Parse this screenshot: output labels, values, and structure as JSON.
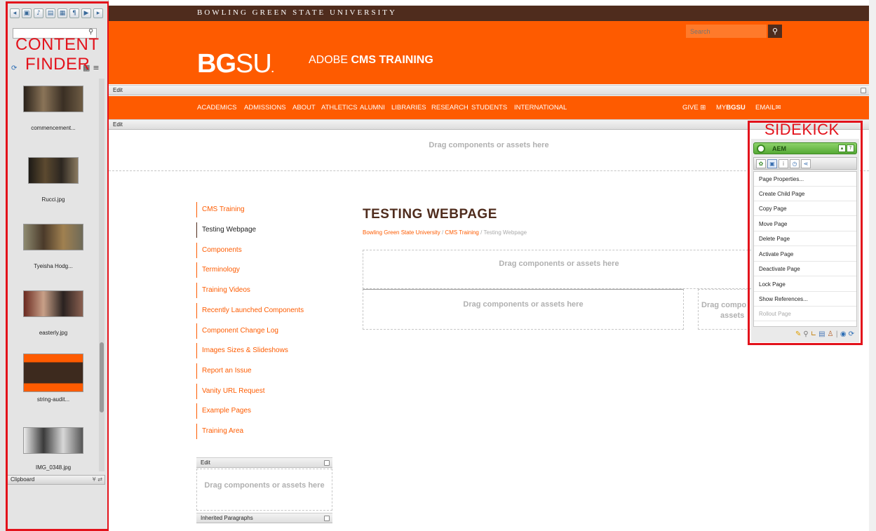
{
  "annotations": {
    "content_finder_line1": "CONTENT",
    "content_finder_line2": "FINDER",
    "sidekick": "SIDEKICK",
    "outline_color": "#e3121b"
  },
  "content_finder": {
    "toolbar_icons": [
      "back-icon",
      "image-icon",
      "document-icon",
      "page-icon",
      "product-icon",
      "paragraph-icon",
      "movie-icon",
      "forward-icon"
    ],
    "search_placeholder": "",
    "assets": [
      {
        "caption": "commencement...",
        "thumb_color": "#5a4c3a"
      },
      {
        "caption": "Rucci.jpg",
        "thumb_color": "#3b332a"
      },
      {
        "caption": "Tyeisha Hodg...",
        "thumb_color": "#8a7a60"
      },
      {
        "caption": "easterly.jpg",
        "thumb_color": "#7a3a2a"
      },
      {
        "caption": "string-audit...",
        "thumb_color": "#3d2a1e"
      },
      {
        "caption": "IMG_0348.jpg",
        "thumb_color": "#6a6a6a"
      }
    ],
    "clipboard_label": "Clipboard"
  },
  "header": {
    "university_name": "BOWLING GREEN STATE UNIVERSITY",
    "logo_bold": "BG",
    "logo_rest": "SU",
    "logo_mark": ".",
    "site_title_light": "ADOBE ",
    "site_title_bold": "CMS TRAINING",
    "search_placeholder": "Search",
    "brand_orange": "#fe5b00",
    "brand_brown": "#4f2c1d"
  },
  "edit_bars": {
    "header_edit": "Edit",
    "nav_edit": "Edit",
    "sidebar_edit": "Edit",
    "inherited_paragraphs": "Inherited Paragraphs"
  },
  "nav": {
    "items": [
      "ACADEMICS",
      "ADMISSIONS",
      "ABOUT",
      "ATHLETICS",
      "ALUMNI",
      "LIBRARIES",
      "RESEARCH",
      "STUDENTS",
      "INTERNATIONAL"
    ],
    "give": "GIVE",
    "my_prefix": "MY",
    "my_bold": "BGSU",
    "email": "EMAIL"
  },
  "drop_zone_text": "Drag components or assets here",
  "drop_zone_partial_1": "Drag compo",
  "drop_zone_partial_2": "assets",
  "left_nav": {
    "items": [
      "CMS Training",
      "Testing Webpage",
      "Components",
      "Terminology",
      "Training Videos",
      "Recently Launched Components",
      "Component Change Log",
      "Images Sizes & Slideshows",
      "Report an Issue",
      "Vanity URL Request",
      "Example Pages",
      "Training Area"
    ],
    "current_index": 1
  },
  "main": {
    "page_title": "TESTING WEBPAGE",
    "breadcrumb": [
      "Bowling Green State University",
      "CMS Training",
      "Testing Webpage"
    ],
    "breadcrumb_separator": "/"
  },
  "sidekick": {
    "title": "AEM",
    "tab_icons": [
      "components-icon",
      "page-tab-icon",
      "info-icon",
      "versioning-icon",
      "workflow-icon"
    ],
    "menu_items": [
      "Page Properties...",
      "Create Child Page",
      "Copy Page",
      "Move Page",
      "Delete Page",
      "Activate Page",
      "Deactivate Page",
      "Lock Page",
      "Show References...",
      "Rollout Page"
    ],
    "disabled_items": [
      "Rollout Page"
    ],
    "footer_icons": [
      "edit-mode-icon",
      "preview-icon",
      "design-icon",
      "scaffold-icon",
      "client-context-icon",
      "website-admin-icon",
      "refresh-icon"
    ],
    "accent_green": "#55a935"
  }
}
